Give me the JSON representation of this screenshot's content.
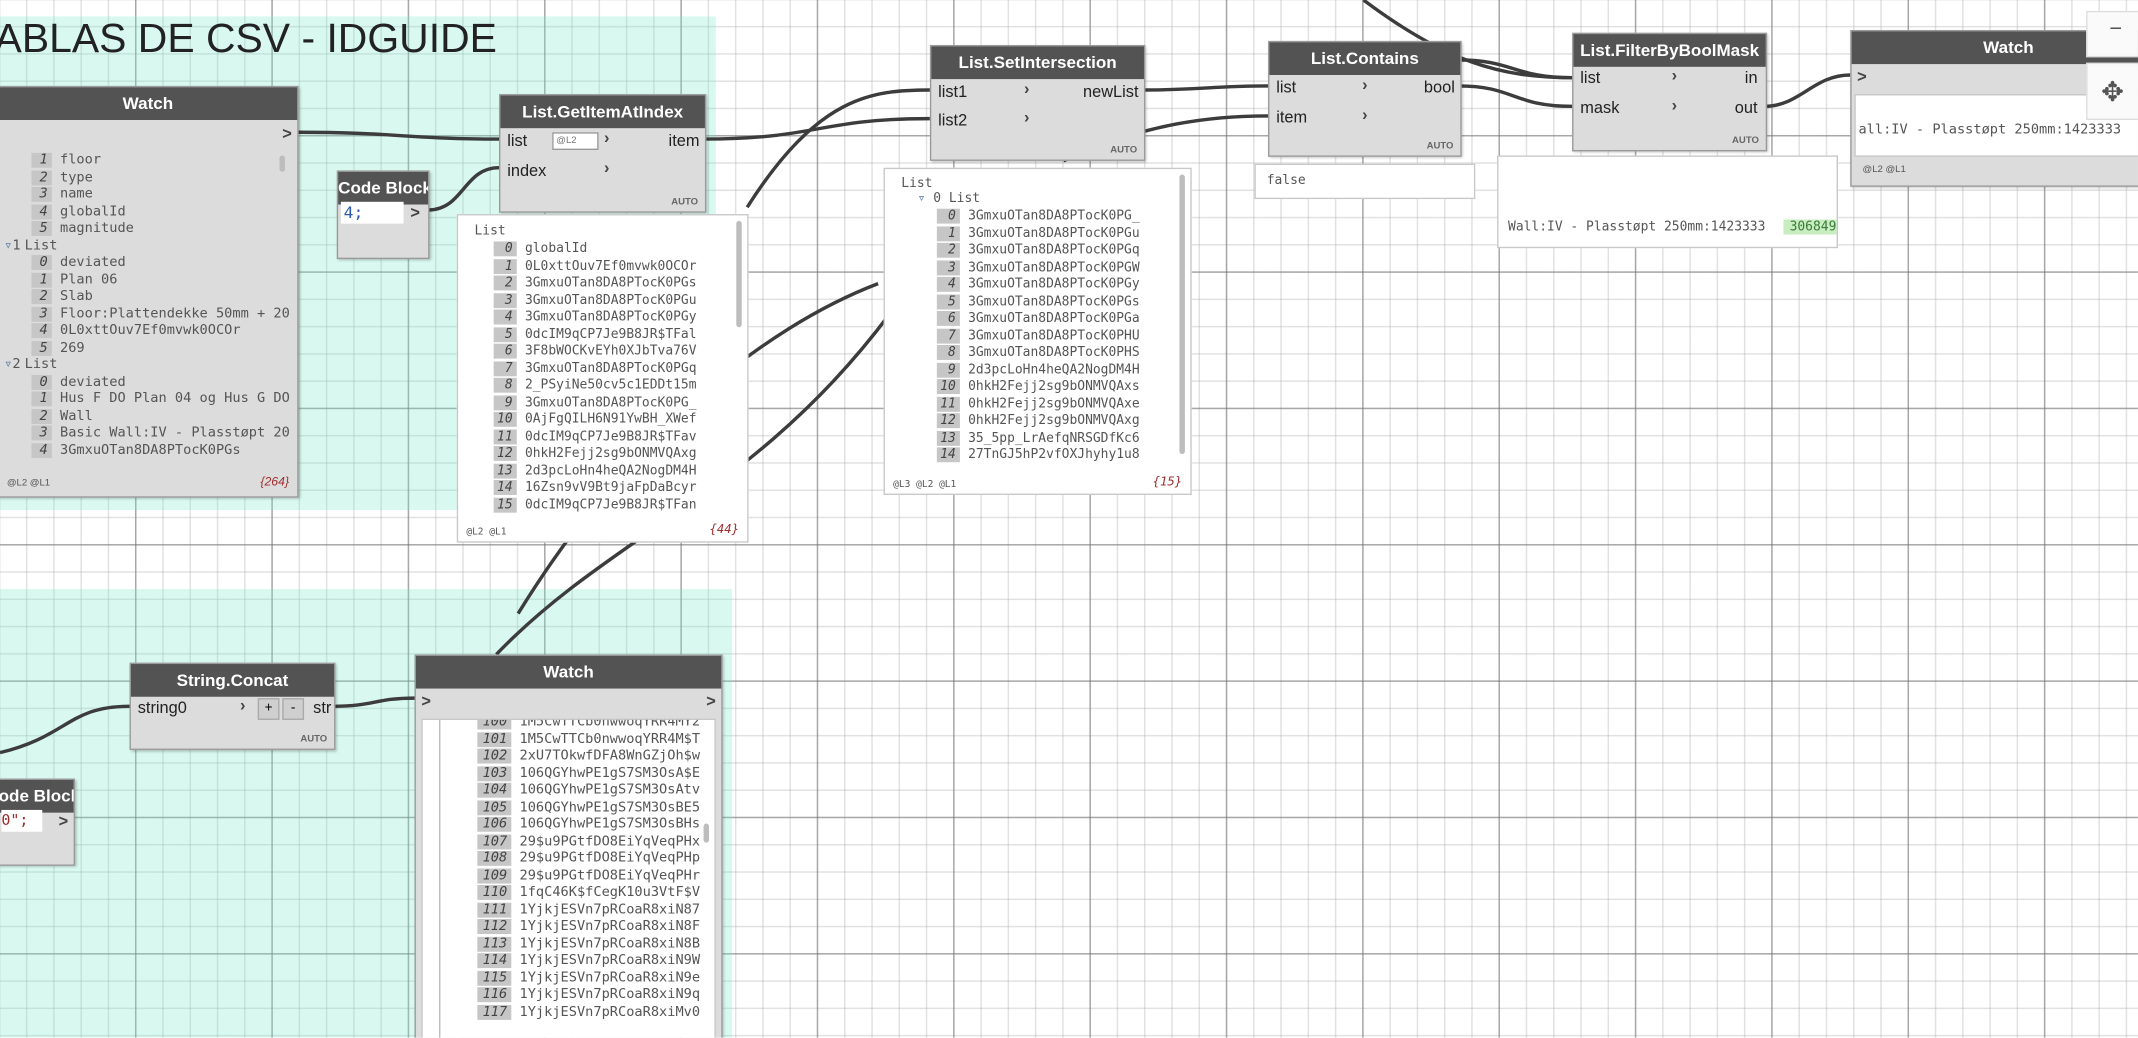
{
  "group1": {
    "title": "ABLAS DE CSV - IDGUIDE"
  },
  "watch1": {
    "title": "Watch",
    "out": ">",
    "rows": [
      {
        "i": "1",
        "t": "floor"
      },
      {
        "i": "2",
        "t": "type"
      },
      {
        "i": "3",
        "t": "name"
      },
      {
        "i": "4",
        "t": "globalId"
      },
      {
        "i": "5",
        "t": "magnitude"
      },
      {
        "i": "1",
        "t": "List",
        "h": true
      },
      {
        "i": "0",
        "t": "deviated"
      },
      {
        "i": "1",
        "t": "Plan 06"
      },
      {
        "i": "2",
        "t": "Slab"
      },
      {
        "i": "3",
        "t": "Floor:Plattendekke 50mm + 20"
      },
      {
        "i": "4",
        "t": "0L0xttOuv7Ef0mvwk0OCOr"
      },
      {
        "i": "5",
        "t": "269"
      },
      {
        "i": "2",
        "t": "List",
        "h": true
      },
      {
        "i": "0",
        "t": "deviated"
      },
      {
        "i": "1",
        "t": "Hus F DO Plan 04 og Hus G DO"
      },
      {
        "i": "2",
        "t": "Wall"
      },
      {
        "i": "3",
        "t": "Basic Wall:IV - Plasstøpt 20"
      },
      {
        "i": "4",
        "t": "3GmxuOTan8DA8PTocK0PGs"
      }
    ],
    "levels": "@L2 @L1",
    "count": "{264}"
  },
  "codeblock1": {
    "title": "Code Block",
    "code": "4;",
    "out": ">"
  },
  "getitem": {
    "title": "List.GetItemAtIndex",
    "in1": "list",
    "in2": "index",
    "out": "item",
    "level": "@L2",
    "auto": "AUTO"
  },
  "preview_getitem": {
    "header": "List",
    "rows": [
      {
        "i": "0",
        "t": "globalId"
      },
      {
        "i": "1",
        "t": "0L0xttOuv7Ef0mvwk0OCOr"
      },
      {
        "i": "2",
        "t": "3GmxuOTan8DA8PTocK0PGs"
      },
      {
        "i": "3",
        "t": "3GmxuOTan8DA8PTocK0PGu"
      },
      {
        "i": "4",
        "t": "3GmxuOTan8DA8PTocK0PGy"
      },
      {
        "i": "5",
        "t": "0dcIM9qCP7Je9B8JR$TFal"
      },
      {
        "i": "6",
        "t": "3F8bWOCKvEYh0XJbTva76V"
      },
      {
        "i": "7",
        "t": "3GmxuOTan8DA8PTocK0PGq"
      },
      {
        "i": "8",
        "t": "2_PSyiNe50cv5c1EDDt15m"
      },
      {
        "i": "9",
        "t": "3GmxuOTan8DA8PTocK0PG_"
      },
      {
        "i": "10",
        "t": "0AjFgQILH6N91YwBH_XWef"
      },
      {
        "i": "11",
        "t": "0dcIM9qCP7Je9B8JR$TFav"
      },
      {
        "i": "12",
        "t": "0hkH2Fejj2sg9bONMVQAxg"
      },
      {
        "i": "13",
        "t": "2d3pcLoHn4heQA2NogDM4H"
      },
      {
        "i": "14",
        "t": "16Zsn9vV9Bt9jaFpDaBcyr"
      },
      {
        "i": "15",
        "t": "0dcIM9qCP7Je9B8JR$TFan"
      }
    ],
    "levels": "@L2 @L1",
    "count": "{44}"
  },
  "setint": {
    "title": "List.SetIntersection",
    "in1": "list1",
    "in2": "list2",
    "out": "newList",
    "auto": "AUTO"
  },
  "preview_setint": {
    "header": "List",
    "sub": "0 List",
    "rows": [
      {
        "i": "0",
        "t": "3GmxuOTan8DA8PTocK0PG_"
      },
      {
        "i": "1",
        "t": "3GmxuOTan8DA8PTocK0PGu"
      },
      {
        "i": "2",
        "t": "3GmxuOTan8DA8PTocK0PGq"
      },
      {
        "i": "3",
        "t": "3GmxuOTan8DA8PTocK0PGW"
      },
      {
        "i": "4",
        "t": "3GmxuOTan8DA8PTocK0PGy"
      },
      {
        "i": "5",
        "t": "3GmxuOTan8DA8PTocK0PGs"
      },
      {
        "i": "6",
        "t": "3GmxuOTan8DA8PTocK0PGa"
      },
      {
        "i": "7",
        "t": "3GmxuOTan8DA8PTocK0PHU"
      },
      {
        "i": "8",
        "t": "3GmxuOTan8DA8PTocK0PHS"
      },
      {
        "i": "9",
        "t": "2d3pcLoHn4heQA2NogDM4H"
      },
      {
        "i": "10",
        "t": "0hkH2Fejj2sg9bONMVQAxs"
      },
      {
        "i": "11",
        "t": "0hkH2Fejj2sg9bONMVQAxe"
      },
      {
        "i": "12",
        "t": "0hkH2Fejj2sg9bONMVQAxg"
      },
      {
        "i": "13",
        "t": "35_5pp_LrAefqNRSGDfKc6"
      },
      {
        "i": "14",
        "t": "27TnGJ5hP2vfOXJhyhy1u8"
      }
    ],
    "levels": "@L3 @L2 @L1",
    "count": "{15}"
  },
  "contains": {
    "title": "List.Contains",
    "in1": "list",
    "in2": "item",
    "out": "bool",
    "auto": "AUTO",
    "result": "false"
  },
  "filter": {
    "title": "List.FilterByBoolMask",
    "in1": "list",
    "in2": "mask",
    "out1": "in",
    "out2": "out",
    "auto": "AUTO",
    "result": "Wall:IV - Plasstøpt 250mm:1423333",
    "badge": "306849"
  },
  "watch2": {
    "title": "Watch",
    "in": ">",
    "value": "all:IV - Plasstøpt 250mm:1423333",
    "badge": "3068",
    "levels": "@L2 @L1"
  },
  "concat": {
    "title": "String.Concat",
    "in1": "string0",
    "out": "str",
    "plus": "+",
    "minus": "-",
    "auto": "AUTO"
  },
  "codeblock2": {
    "title": "ode Block",
    "code": "0\";",
    "out": ">"
  },
  "watch3": {
    "title": "Watch",
    "in": ">",
    "out": ">",
    "rows": [
      {
        "i": "100",
        "t": "1M5CwTTCb0nwwoqYRR4MY2"
      },
      {
        "i": "101",
        "t": "1M5CwTTCb0nwwoqYRR4M$T"
      },
      {
        "i": "102",
        "t": "2xU7TOkwfDFA8WnGZjOh$w"
      },
      {
        "i": "103",
        "t": "106QGYhwPE1gS7SM3OsA$E"
      },
      {
        "i": "104",
        "t": "106QGYhwPE1gS7SM3OsAtv"
      },
      {
        "i": "105",
        "t": "106QGYhwPE1gS7SM3OsBE5"
      },
      {
        "i": "106",
        "t": "106QGYhwPE1gS7SM3OsBHs"
      },
      {
        "i": "107",
        "t": "29$u9PGtfDO8EiYqVeqPHx"
      },
      {
        "i": "108",
        "t": "29$u9PGtfDO8EiYqVeqPHp"
      },
      {
        "i": "109",
        "t": "29$u9PGtfDO8EiYqVeqPHr"
      },
      {
        "i": "110",
        "t": "1fqC46K$fCegK10u3VtF$V"
      },
      {
        "i": "111",
        "t": "1YjkjESVn7pRCoaR8xiN87"
      },
      {
        "i": "112",
        "t": "1YjkjESVn7pRCoaR8xiN8F"
      },
      {
        "i": "113",
        "t": "1YjkjESVn7pRCoaR8xiN8B"
      },
      {
        "i": "114",
        "t": "1YjkjESVn7pRCoaR8xiN9W"
      },
      {
        "i": "115",
        "t": "1YjkjESVn7pRCoaR8xiN9e"
      },
      {
        "i": "116",
        "t": "1YjkjESVn7pRCoaR8xiN9q"
      },
      {
        "i": "117",
        "t": "1YjkjESVn7pRCoaR8xiMv0"
      }
    ]
  },
  "toolbar": {
    "minimize": "−",
    "pan": "✥"
  }
}
